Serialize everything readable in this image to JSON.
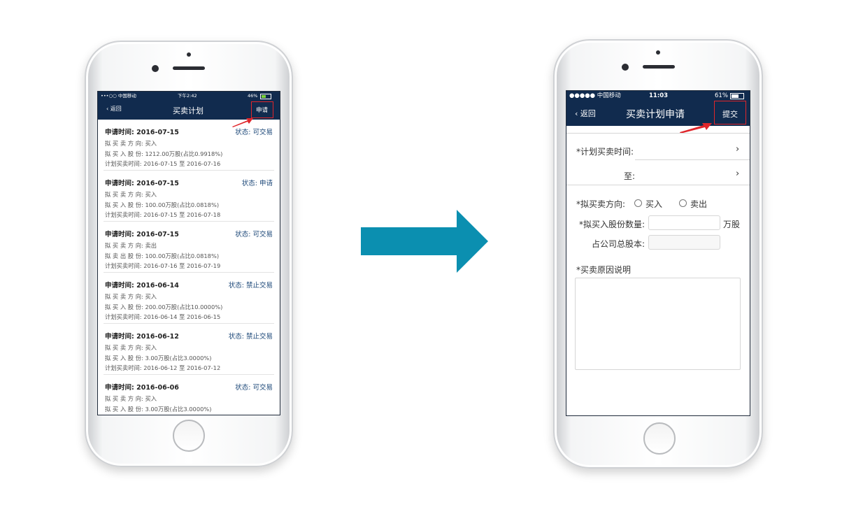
{
  "left_phone": {
    "status": {
      "carrier": "•••○○ 中国移动",
      "time": "下午2:42",
      "battery": "46%"
    },
    "nav": {
      "back": "返回",
      "title": "买卖计划",
      "action": "申请"
    },
    "records": [
      {
        "apply": "申请时间: 2016-07-15",
        "status": "状态: 可交易",
        "direction": "拟 买 卖 方 向: 买入",
        "shares": "拟 买 入 股 份: 1212.00万股(占比0.9918%)",
        "period": "计划买卖时间: 2016-07-15 至 2016-07-16"
      },
      {
        "apply": "申请时间: 2016-07-15",
        "status": "状态: 申请",
        "direction": "拟 买 卖 方 向: 买入",
        "shares": "拟 买 入 股 份: 100.00万股(占比0.0818%)",
        "period": "计划买卖时间: 2016-07-15 至 2016-07-18"
      },
      {
        "apply": "申请时间: 2016-07-15",
        "status": "状态: 可交易",
        "direction": "拟 买 卖 方 向: 卖出",
        "shares": "拟 卖 出 股 份: 100.00万股(占比0.0818%)",
        "period": "计划买卖时间: 2016-07-16 至 2016-07-19"
      },
      {
        "apply": "申请时间: 2016-06-14",
        "status": "状态: 禁止交易",
        "direction": "拟 买 卖 方 向: 买入",
        "shares": "拟 买 入 股 份: 200.00万股(占比10.0000%)",
        "period": "计划买卖时间: 2016-06-14 至 2016-06-15"
      },
      {
        "apply": "申请时间: 2016-06-12",
        "status": "状态: 禁止交易",
        "direction": "拟 买 卖 方 向: 买入",
        "shares": "拟 买 入 股 份: 3.00万股(占比3.0000%)",
        "period": "计划买卖时间: 2016-06-12 至 2016-07-12"
      },
      {
        "apply": "申请时间: 2016-06-06",
        "status": "状态: 可交易",
        "direction": "拟 买 卖 方 向: 买入",
        "shares": "拟 买 入 股 份: 3.00万股(占比3.0000%)",
        "period": ""
      }
    ]
  },
  "right_phone": {
    "status": {
      "carrier": "●●●●● 中国移动",
      "time": "11:03",
      "battery": "61%"
    },
    "nav": {
      "back": "返回",
      "title": "买卖计划申请",
      "action": "提交"
    },
    "form": {
      "time_label": "*计划买卖时间:",
      "to_label": "至:",
      "direction_label": "*拟买卖方向:",
      "buy_option": "买入",
      "sell_option": "卖出",
      "quantity_label": "*拟买入股份数量:",
      "quantity_unit": "万股",
      "ratio_label": "占公司总股本:",
      "reason_label": "*买卖原因说明"
    }
  },
  "colors": {
    "navy": "#112b4e",
    "arrow": "#0b8fb0",
    "highlight": "#e0262b"
  }
}
